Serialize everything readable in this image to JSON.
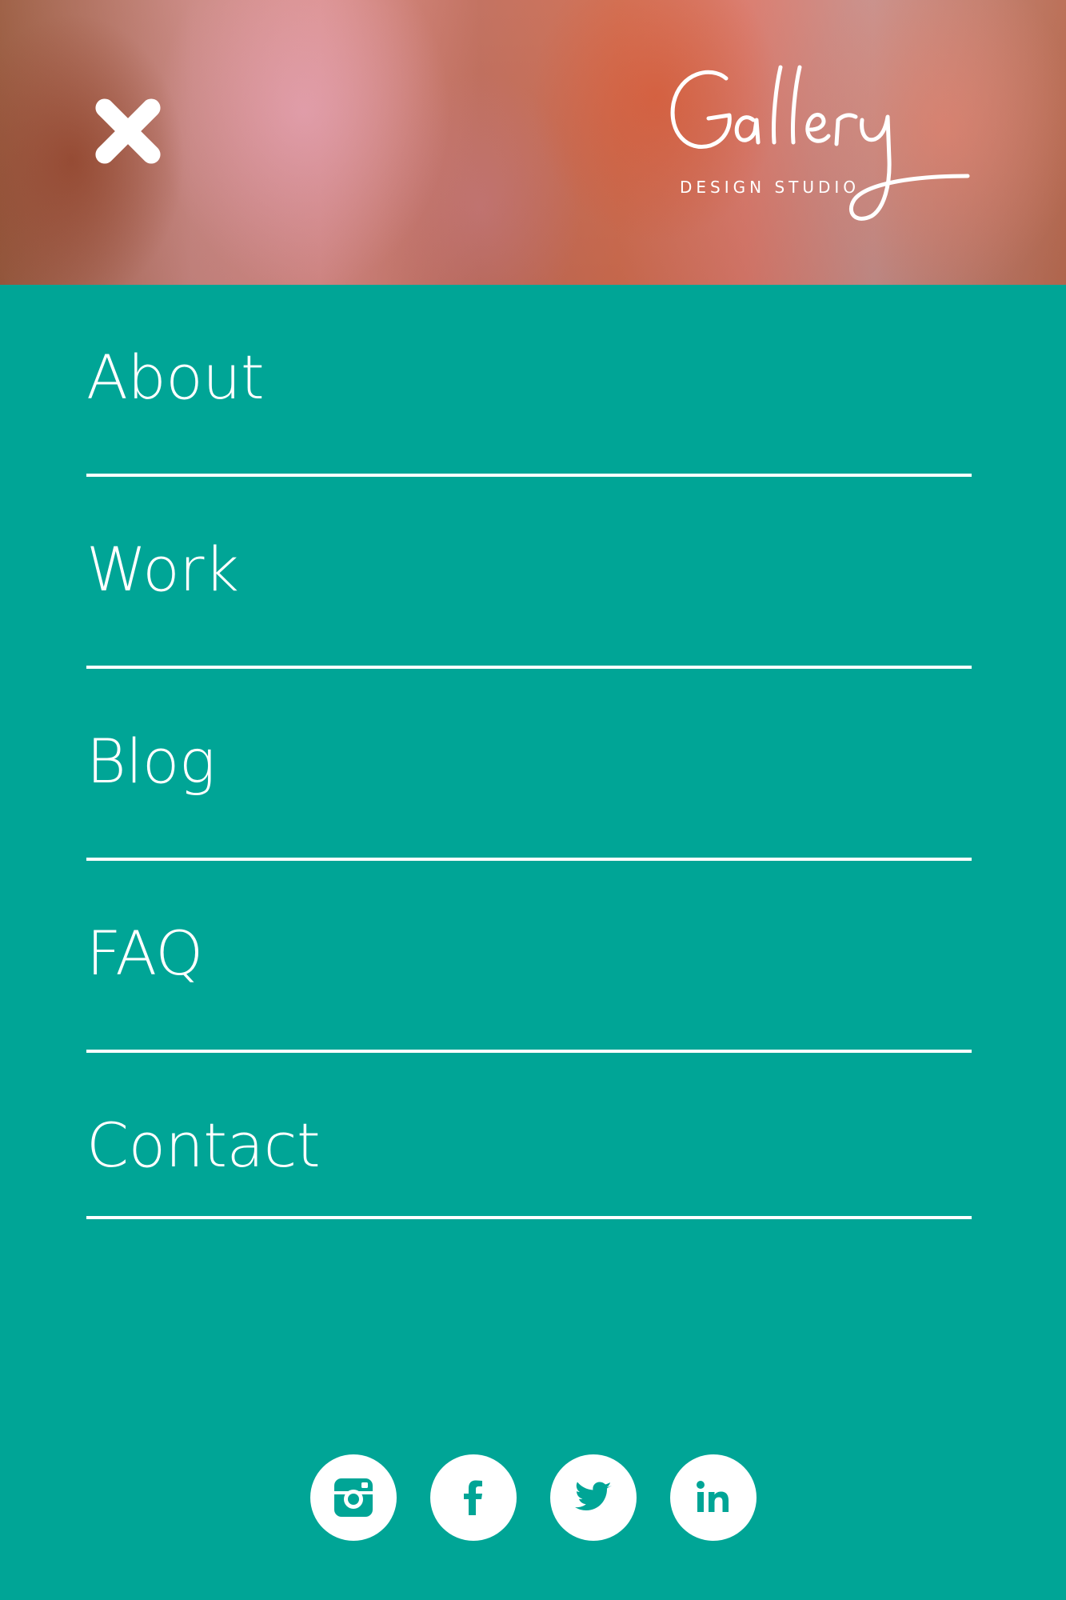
{
  "header": {
    "logo": {
      "name": "Gallery",
      "tagline": "DESIGN STUDIO"
    },
    "close_icon": "close-icon"
  },
  "menu": {
    "items": [
      {
        "label": "About"
      },
      {
        "label": "Work"
      },
      {
        "label": "Blog"
      },
      {
        "label": "FAQ"
      },
      {
        "label": "Contact"
      }
    ]
  },
  "social": {
    "icons": [
      "instagram-icon",
      "facebook-icon",
      "twitter-icon",
      "linkedin-icon"
    ]
  },
  "colors": {
    "background": "#00A596",
    "foreground": "#FFFFFF"
  }
}
